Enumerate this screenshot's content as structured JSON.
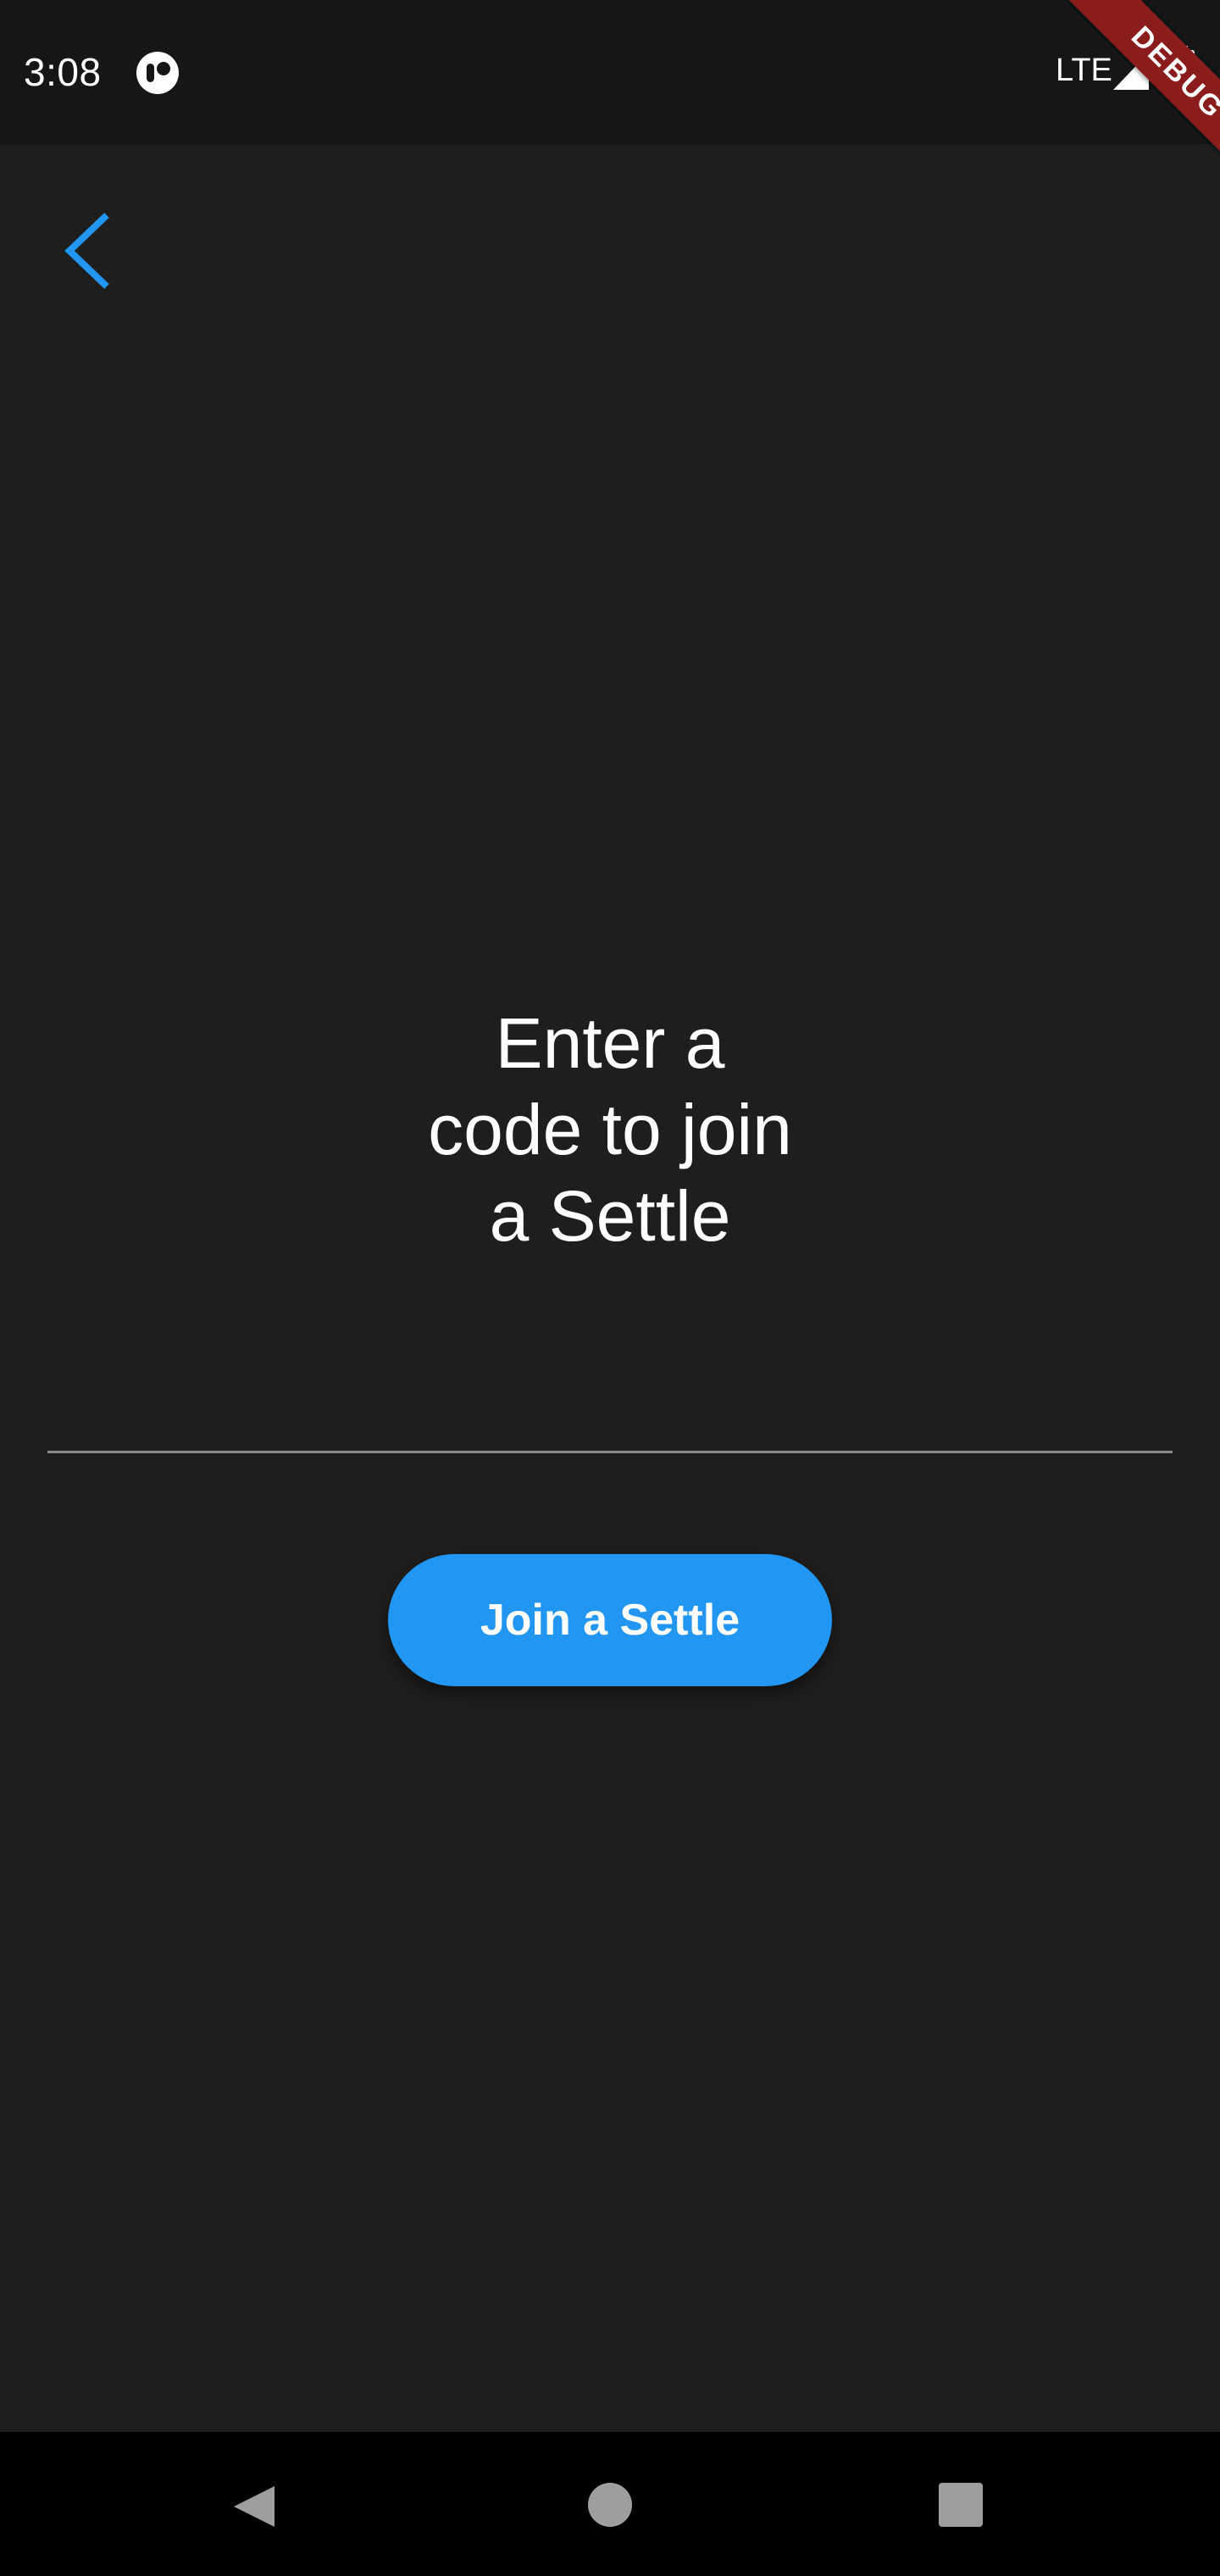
{
  "status_bar": {
    "time": "3:08",
    "network": "LTE",
    "app_icon": "app-notification-icon",
    "signal_icon": "signal-icon",
    "battery_icon": "battery-icon"
  },
  "debug_banner": {
    "label": "DEBUG",
    "color": "#8b1c1c"
  },
  "header": {
    "back_icon": "chevron-left-icon",
    "accent_color": "#2196f3"
  },
  "main": {
    "heading_lines": [
      "Enter a",
      "code to join",
      "a Settle"
    ],
    "code_input": {
      "value": "",
      "placeholder": ""
    },
    "join_button_label": "Join a Settle",
    "join_button_color": "#2196f3"
  },
  "nav_bar": {
    "back_icon": "nav-back-icon",
    "home_icon": "nav-home-icon",
    "recents_icon": "nav-recents-icon"
  }
}
